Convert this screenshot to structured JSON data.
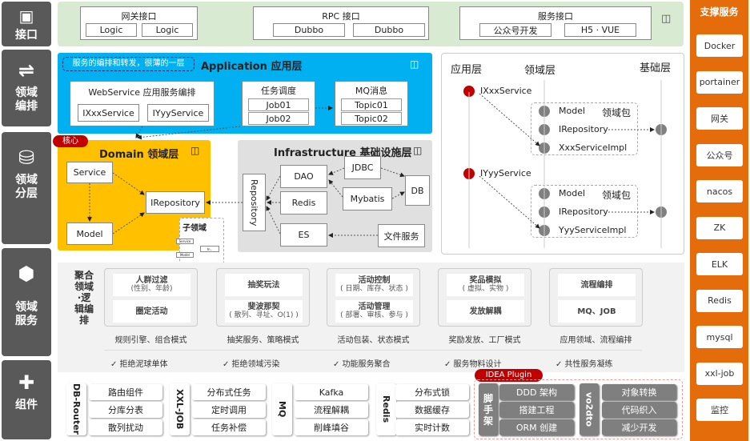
{
  "left_nav": [
    {
      "label": "接口",
      "icon": "interface-icon"
    },
    {
      "label": "领域编排",
      "icon": "orchestration-icon"
    },
    {
      "label": "领域分层",
      "icon": "database-layers-icon"
    },
    {
      "label": "领域服务",
      "icon": "hexagons-icon"
    },
    {
      "label": "组件",
      "icon": "puzzle-icon"
    }
  ],
  "interface": {
    "groups": [
      {
        "title": "网关接口",
        "items": [
          "Logic",
          "Logic"
        ]
      },
      {
        "title": "RPC 接口",
        "items": [
          "Dubbo",
          "Dubbo"
        ]
      },
      {
        "title": "服务接口",
        "items": [
          "公众号开发",
          "H5 · VUE"
        ]
      }
    ]
  },
  "application": {
    "title": "Application 应用层",
    "note": "服务的编排和转发，很薄的一层",
    "webservice": {
      "title": "WebService 应用服务编排",
      "items": [
        "IXxxService",
        "IYyyService"
      ]
    },
    "task": {
      "title": "任务调度",
      "items": [
        "Job01",
        "Job02"
      ]
    },
    "mq": {
      "title": "MQ消息",
      "items": [
        "Topic01",
        "Topic02"
      ]
    }
  },
  "domain": {
    "tag": "核心",
    "title": "Domain 领域层",
    "service": "Service",
    "irepository": "IRepository",
    "model": "Model",
    "sub": {
      "title": "子领域",
      "service": "Service",
      "ir": "In..",
      "model": "Model"
    }
  },
  "infra": {
    "title": "Infrastructure 基础设施层",
    "repository": "Repository",
    "dao": "DAO",
    "redis": "Redis",
    "es": "ES",
    "jdbc": "JDBC",
    "mybatis": "Mybatis",
    "db": "DB",
    "file": "文件服务"
  },
  "layers": {
    "headers": [
      "应用层",
      "领域层",
      "基础层"
    ],
    "services": [
      "IXxxService",
      "IYyyService"
    ],
    "packages": [
      {
        "label": "领域包",
        "items": [
          "Model",
          "IRepository",
          "XxxServiceImpl"
        ]
      },
      {
        "label": "领域包",
        "items": [
          "Model",
          "IRepository",
          "YyyServiceImpl"
        ]
      }
    ]
  },
  "domain_service": {
    "label": "聚合领域·逻辑编排",
    "cards": [
      {
        "items": [
          {
            "t": "人群过滤",
            "s": "(性别、年龄)"
          },
          {
            "t": "圈定活动",
            "s": ""
          }
        ],
        "caption": "规则引擎、组合模式"
      },
      {
        "items": [
          {
            "t": "抽奖玩法",
            "s": ""
          },
          {
            "t": "斐波那契",
            "s": "( 散列、寻址、O(1) )"
          }
        ],
        "caption": "抽奖服务、策略模式"
      },
      {
        "items": [
          {
            "t": "活动控制",
            "s": "( 日期、库存、状态 )"
          },
          {
            "t": "活动管理",
            "s": "( 部署、审核、参与 )"
          }
        ],
        "caption": "活动包装、状态模式"
      },
      {
        "items": [
          {
            "t": "奖品模拟",
            "s": "( 虚拟、实物 )"
          },
          {
            "t": "发放解耦",
            "s": ""
          }
        ],
        "caption": "奖励发放、工厂模式"
      },
      {
        "items": [
          {
            "t": "流程编排",
            "s": ""
          },
          {
            "t": "MQ、JOB",
            "s": ""
          }
        ],
        "caption": "应用领域、流程编排"
      }
    ],
    "checks": [
      "✓  拒绝泥球单体",
      "✓  拒绝领域污染",
      "✓  功能服务聚合",
      "✓  服务物料设计",
      "✓  共性服务凝练"
    ]
  },
  "components": [
    {
      "label": "DB-Router",
      "items": [
        "路由组件",
        "分库分表",
        "散列扰动"
      ]
    },
    {
      "label": "XXL-JOB",
      "items": [
        "分布式任务",
        "定时调用",
        "任务补偿"
      ]
    },
    {
      "label": "MQ",
      "items": [
        "Kafka",
        "流程解耦",
        "削峰填谷"
      ]
    },
    {
      "label": "Redis",
      "items": [
        "分布式锁",
        "数据缓存",
        "实时计数"
      ]
    }
  ],
  "plugin": {
    "tag": "IDEA Plugin",
    "groups": [
      {
        "label": "脚手架",
        "items": [
          "DDD 架构",
          "搭建工程",
          "ORM 创建"
        ]
      },
      {
        "label": "vo2dto",
        "items": [
          "对象转换",
          "代码织入",
          "减少开发"
        ]
      }
    ]
  },
  "support": {
    "title": "支撑服务",
    "items": [
      "Docker",
      "portainer",
      "网关",
      "公众号",
      "nacos",
      "ZK",
      "ELK",
      "Redis",
      "mysql",
      "xxl-job",
      "监控"
    ]
  },
  "colors": {
    "sidebar": "#595959",
    "application": "#00b0f0",
    "domain": "#ffc000",
    "infra": "#e0e0e0",
    "support": "#e46c0a",
    "core": "#c00000",
    "interface": "#d8ead2"
  }
}
